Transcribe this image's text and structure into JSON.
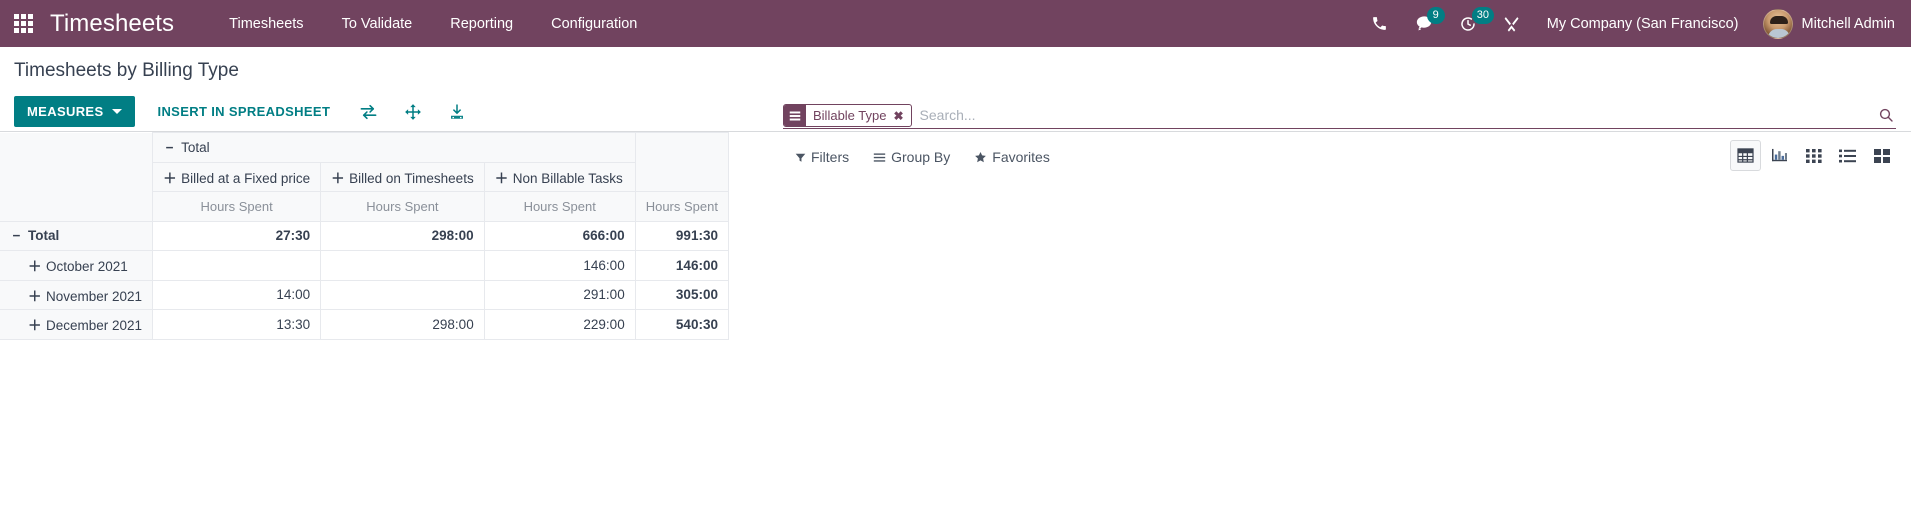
{
  "navbar": {
    "apps_icon": "grid-apps-icon",
    "brand": "Timesheets",
    "menu_items": [
      {
        "label": "Timesheets"
      },
      {
        "label": "To Validate"
      },
      {
        "label": "Reporting"
      },
      {
        "label": "Configuration"
      }
    ],
    "icons": [
      {
        "name": "phone-icon",
        "badge": null
      },
      {
        "name": "messages-icon",
        "badge": "9"
      },
      {
        "name": "activities-clock-icon",
        "badge": "30"
      },
      {
        "name": "developer-tools-icon",
        "badge": null
      }
    ],
    "company": "My Company (San Francisco)",
    "user": "Mitchell Admin",
    "bg_color": "#71435f"
  },
  "control_panel": {
    "title": "Timesheets by Billing Type",
    "measures_label": "MEASURES",
    "insert_spreadsheet_label": "INSERT IN SPREADSHEET",
    "icon_buttons": [
      {
        "name": "flip-axis-icon",
        "title": "Flip axis"
      },
      {
        "name": "expand-all-icon",
        "title": "Expand all"
      },
      {
        "name": "download-xlsx-icon",
        "title": "Download xlsx"
      }
    ],
    "accent_color": "#017e84"
  },
  "search": {
    "facets": [
      {
        "icon": "group-by-icon",
        "label": "Billable Type",
        "close": "✖"
      }
    ],
    "placeholder": "Search...",
    "value": "",
    "magnifier_icon": "search-icon"
  },
  "filter_menus": [
    {
      "name": "filters",
      "label": "Filters",
      "icon": "filter-funnel-icon"
    },
    {
      "name": "group-by",
      "label": "Group By",
      "icon": "group-by-bars-icon"
    },
    {
      "name": "favorites",
      "label": "Favorites",
      "icon": "star-icon"
    }
  ],
  "view_switcher": {
    "views": [
      {
        "name": "pivot-view",
        "icon": "pivot-table-icon",
        "active": true
      },
      {
        "name": "graph-view",
        "icon": "bar-chart-icon",
        "active": false
      },
      {
        "name": "kanban-view",
        "icon": "grid-squares-icon",
        "active": false
      },
      {
        "name": "list-view",
        "icon": "list-icon",
        "active": false
      },
      {
        "name": "cohort-view",
        "icon": "blocks-icon",
        "active": false
      }
    ]
  },
  "pivot": {
    "col_group_root": {
      "toggle": "−",
      "label": "Total"
    },
    "col_headers": [
      {
        "toggle": "＋",
        "label": "Billed at a Fixed price"
      },
      {
        "toggle": "＋",
        "label": "Billed on Timesheets"
      },
      {
        "toggle": "＋",
        "label": "Non Billable Tasks"
      }
    ],
    "measure_label": "Hours Spent",
    "rows": [
      {
        "toggle": "−",
        "label": "Total",
        "is_total": true,
        "indent": false,
        "values": [
          "27:30",
          "298:00",
          "666:00"
        ],
        "total": "991:30"
      },
      {
        "toggle": "＋",
        "label": "October 2021",
        "is_total": false,
        "indent": true,
        "values": [
          "",
          "",
          "146:00"
        ],
        "total": "146:00"
      },
      {
        "toggle": "＋",
        "label": "November 2021",
        "is_total": false,
        "indent": true,
        "values": [
          "14:00",
          "",
          "291:00"
        ],
        "total": "305:00"
      },
      {
        "toggle": "＋",
        "label": "December 2021",
        "is_total": false,
        "indent": true,
        "values": [
          "13:30",
          "298:00",
          "229:00"
        ],
        "total": "540:30"
      }
    ]
  }
}
